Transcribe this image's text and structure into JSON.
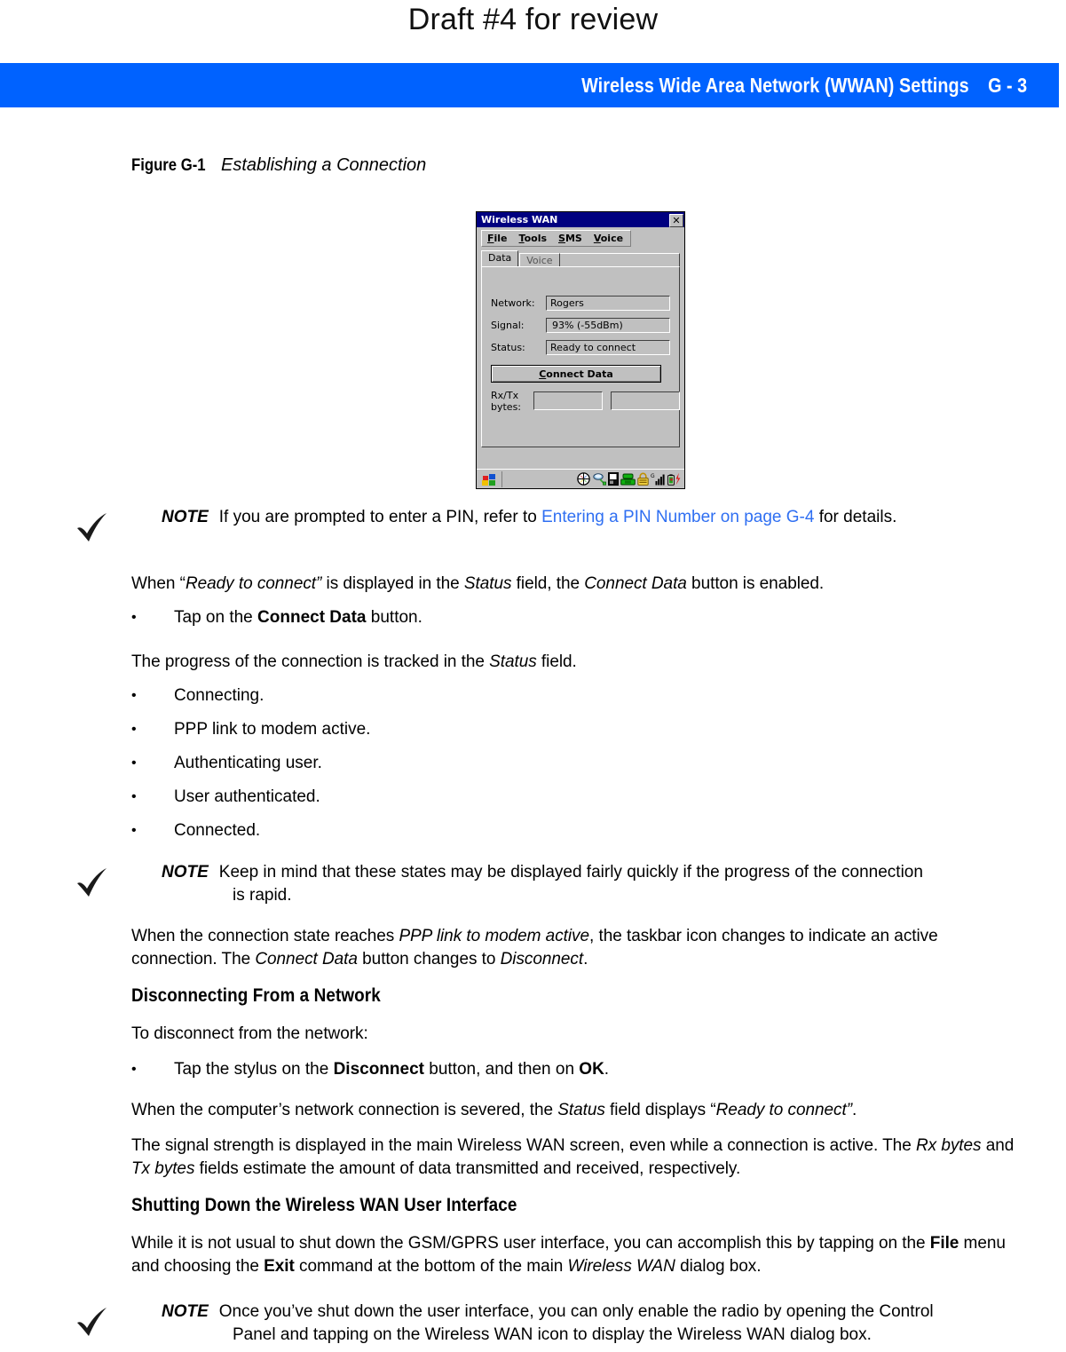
{
  "draft_notice": "Draft #4 for review",
  "header": {
    "title": "Wireless Wide Area Network (WWAN) Settings",
    "page_number": "G - 3",
    "band_color": "#0062ff"
  },
  "figure": {
    "number": "Figure G-1",
    "caption": "Establishing a Connection"
  },
  "dialog": {
    "title": "Wireless WAN",
    "close_label": "✕",
    "menus": [
      {
        "mnemonic": "F",
        "rest": "ile"
      },
      {
        "mnemonic": "T",
        "rest": "ools"
      },
      {
        "mnemonic": "S",
        "rest": "MS"
      },
      {
        "mnemonic": "V",
        "rest": "oice"
      }
    ],
    "tabs": [
      {
        "label": "Data",
        "active": true
      },
      {
        "label": "Voice",
        "active": false
      }
    ],
    "fields": [
      {
        "label": "Network:",
        "value": "Rogers"
      },
      {
        "label": "Signal:",
        "value": "93% (-55dBm)"
      },
      {
        "label": "Status:",
        "value": "Ready to connect"
      }
    ],
    "button": {
      "mnemonic": "C",
      "rest": "onnect Data",
      "full_label": "Connect Data"
    },
    "rx_tx": {
      "label_line1": "Rx/Tx",
      "label_line2": "bytes:",
      "rx_value": "",
      "tx_value": ""
    },
    "taskbar": {
      "start_icon": "windows-start-icon",
      "tray_icons": [
        "globe-internet-icon",
        "network-connection-icon",
        "device-pc-icon",
        "telephone-icon",
        "lock-security-icon",
        "gprs-signal-bars-icon",
        "battery-charging-icon"
      ]
    }
  },
  "notes": {
    "note_label": "NOTE",
    "note1": {
      "before_link": "If you are prompted to enter a PIN, refer to ",
      "link": "Entering a PIN Number on page G-4",
      "after_link": " for details."
    },
    "note2": {
      "line1": "Keep in mind that these states may be displayed fairly quickly if the progress of the connection",
      "line2": "is rapid."
    },
    "note3": {
      "line1": "Once you’ve shut down the user interface, you can only enable the radio by opening the Control",
      "line2": "Panel and tapping on the Wireless WAN icon to display the Wireless WAN dialog box."
    }
  },
  "body": {
    "p_ready_connect": {
      "t1": "When “",
      "i1": "Ready to connect”",
      "t2": " is displayed in the ",
      "i2": "Status",
      "t3": " field, the ",
      "i3": "Connect Data",
      "t4": " button is enabled."
    },
    "bullet_tap_connect": {
      "t1": "Tap on the ",
      "b1": "Connect Data",
      "t2": " button."
    },
    "p_progress": {
      "t1": "The progress of the connection is tracked in the ",
      "i1": "Status",
      "t2": " field."
    },
    "state_bullets": [
      "Connecting.",
      "PPP link to modem active.",
      "Authenticating user.",
      "User authenticated.",
      "Connected."
    ],
    "p_ppp_state": {
      "t1": "When the connection state reaches ",
      "i1": "PPP link to modem active",
      "t2": ", the taskbar icon changes to indicate an active",
      "t3": "connection. The ",
      "i2": "Connect Data",
      "t4": " button changes to ",
      "i3": "Disconnect",
      "t5": "."
    },
    "heading_disconnecting": "Disconnecting From a Network",
    "p_to_disconnect": "To disconnect from the network:",
    "bullet_disconnect": {
      "t1": "Tap the stylus on the ",
      "b1": "Disconnect",
      "t2": " button, and then on ",
      "b2": "OK",
      "t3": "."
    },
    "p_severed": {
      "t1": "When the computer’s network connection is severed, the ",
      "i1": "Status",
      "t2": " field displays “",
      "i2": "Ready to connect”",
      "t3": "."
    },
    "p_signal_strength": {
      "t1": "The signal strength is displayed in the main Wireless WAN screen, even while a connection is active. The ",
      "i1": "Rx",
      "t2": "bytes",
      "t3": " and ",
      "i2": "Tx bytes",
      "t4": " fields estimate the amount of data transmitted and received, respectively."
    },
    "heading_shutting_down": "Shutting Down the Wireless WAN User Interface",
    "p_shutdown": {
      "t1": "While it is not usual to shut down the GSM/GPRS user interface, you can accomplish this by tapping on the",
      "b1": "File",
      "t2": " menu and choosing the ",
      "b2": "Exit",
      "t3": " command at the bottom of the main ",
      "i1": "Wireless WAN",
      "t4": " dialog box."
    }
  }
}
